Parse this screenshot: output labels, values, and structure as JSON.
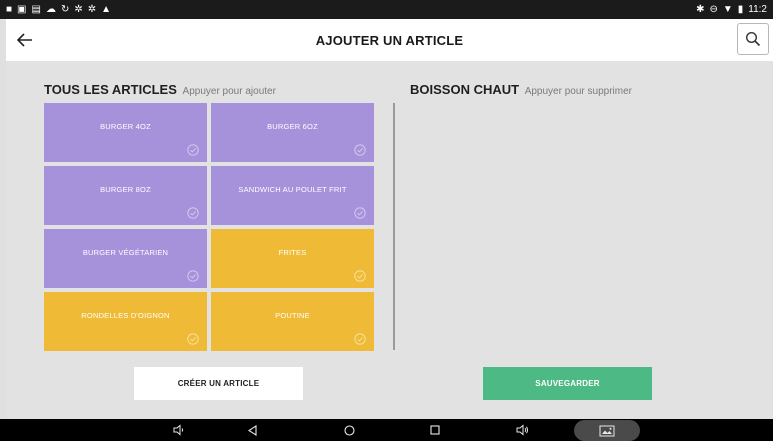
{
  "status_bar": {
    "time": "11:2",
    "left_icons": [
      "notification-icon",
      "image-icon",
      "card-icon",
      "cloud-icon",
      "sync-icon",
      "settings-icon",
      "game-icon",
      "warning-icon"
    ],
    "right_icons": [
      "bluetooth-icon",
      "minus-circle-icon",
      "wifi-icon",
      "battery-icon"
    ]
  },
  "header": {
    "title": "AJOUTER UN ARTICLE"
  },
  "left_panel": {
    "title": "TOUS LES ARTICLES",
    "hint": "Appuyer pour ajouter",
    "items": [
      {
        "label": "BURGER 4OZ",
        "color": "#a692db"
      },
      {
        "label": "BURGER 6OZ",
        "color": "#a692db"
      },
      {
        "label": "BURGER 8OZ",
        "color": "#a692db"
      },
      {
        "label": "SANDWICH AU POULET FRIT",
        "color": "#a692db"
      },
      {
        "label": "BURGER VÉGÉTARIEN",
        "color": "#a692db"
      },
      {
        "label": "FRITES",
        "color": "#efba35"
      },
      {
        "label": "RONDELLES D'OIGNON",
        "color": "#efba35"
      },
      {
        "label": "POUTINE",
        "color": "#efba35"
      }
    ]
  },
  "right_panel": {
    "title": "BOISSON CHAUT",
    "hint": "Appuyer pour supprimer"
  },
  "buttons": {
    "create": "CRÉER UN ARTICLE",
    "save": "SAUVEGARDER"
  },
  "colors": {
    "purple": "#a692db",
    "yellow": "#efba35",
    "save_green": "#4db985"
  }
}
